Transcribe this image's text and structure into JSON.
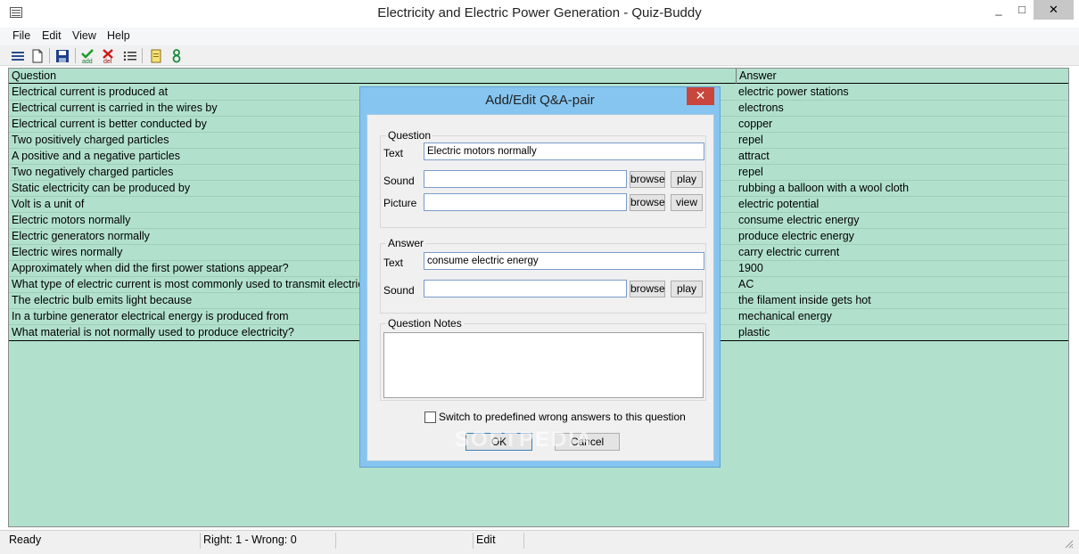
{
  "window": {
    "title": "Electricity and Electric Power Generation - Quiz-Buddy",
    "minimize": "_",
    "maximize": "□",
    "close": "✕"
  },
  "menu": {
    "items": [
      "File",
      "Edit",
      "View",
      "Help"
    ]
  },
  "toolbar": {
    "buttons": [
      "list-icon",
      "new-file-icon",
      "save-icon",
      "add-icon",
      "delete-icon",
      "list-lines-icon",
      "notes-icon",
      "quiz-icon"
    ],
    "add_label": "add",
    "del_label": "del"
  },
  "table": {
    "headers": {
      "question": "Question",
      "answer": "Answer"
    },
    "rows": [
      {
        "q": "Electrical current is produced at",
        "a": "electric power stations"
      },
      {
        "q": "Electrical current is carried in the wires by",
        "a": "electrons"
      },
      {
        "q": "Electrical current is better conducted by",
        "a": "copper"
      },
      {
        "q": "Two positively charged particles",
        "a": "repel"
      },
      {
        "q": "A positive and a negative particles",
        "a": "attract"
      },
      {
        "q": "Two negatively charged particles",
        "a": "repel"
      },
      {
        "q": "Static electricity can be produced by",
        "a": "rubbing a balloon with a wool cloth"
      },
      {
        "q": "Volt is a unit of",
        "a": "electric potential"
      },
      {
        "q": "Electric motors normally",
        "a": "consume electric energy"
      },
      {
        "q": "Electric generators normally",
        "a": "produce electric energy"
      },
      {
        "q": "Electric wires normally",
        "a": "carry electric current"
      },
      {
        "q": "Approximately when did the first power stations appear?",
        "a": "1900"
      },
      {
        "q": "What type of electric current is most commonly used to transmit electricity?",
        "a": "AC"
      },
      {
        "q": "The electric bulb emits light because",
        "a": "the filament inside gets hot"
      },
      {
        "q": "In a turbine generator electrical energy is produced from",
        "a": "mechanical energy"
      },
      {
        "q": "What material is not normally used to produce electricity?",
        "a": "plastic"
      }
    ]
  },
  "status": {
    "state": "Ready",
    "score": "Right: 1 - Wrong: 0",
    "mode": "Edit"
  },
  "dialog": {
    "title": "Add/Edit Q&A-pair",
    "close": "✕",
    "question_group": "Question",
    "answer_group": "Answer",
    "notes_group": "Question Notes",
    "text_label": "Text",
    "sound_label": "Sound",
    "picture_label": "Picture",
    "question_text": "Electric motors normally",
    "answer_text": "consume electric energy",
    "browse": "browse",
    "play": "play",
    "view": "view",
    "checkbox_label": "Switch to predefined wrong answers to this question",
    "ok": "OK",
    "cancel": "Cancel"
  },
  "watermark": "SOFTPEDIA",
  "colors": {
    "table_bg": "#b1e1cd",
    "dialog_frame": "#86c5f0",
    "close_red": "#c9463d"
  }
}
